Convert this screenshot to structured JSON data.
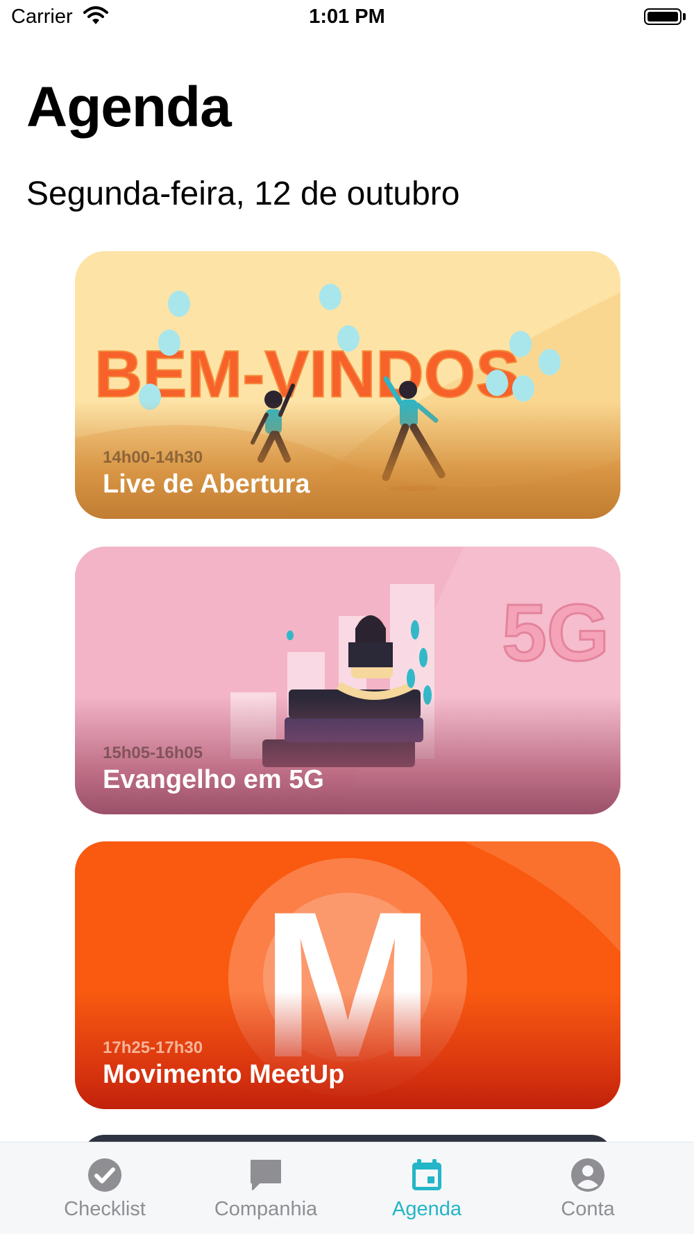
{
  "status_bar": {
    "carrier": "Carrier",
    "time": "1:01 PM",
    "battery_level": 1.0
  },
  "header": {
    "title": "Agenda",
    "date": "Segunda-feira, 12 de outubro"
  },
  "events": [
    {
      "time": "14h00-14h30",
      "title": "Live de Abertura",
      "art_text": "BEM-VINDOS"
    },
    {
      "time": "15h05-16h05",
      "title": "Evangelho em 5G",
      "art_text": "5G"
    },
    {
      "time": "17h25-17h30",
      "title": "Movimento MeetUp",
      "art_text": "M"
    }
  ],
  "tab_bar": {
    "active_color": "#23b5c8",
    "inactive_color": "#8e8e93",
    "tabs": [
      {
        "label": "Checklist",
        "icon": "checkmark-circle-icon"
      },
      {
        "label": "Companhia",
        "icon": "chat-bubble-icon"
      },
      {
        "label": "Agenda",
        "icon": "calendar-icon",
        "active": true
      },
      {
        "label": "Conta",
        "icon": "person-circle-icon"
      }
    ]
  }
}
